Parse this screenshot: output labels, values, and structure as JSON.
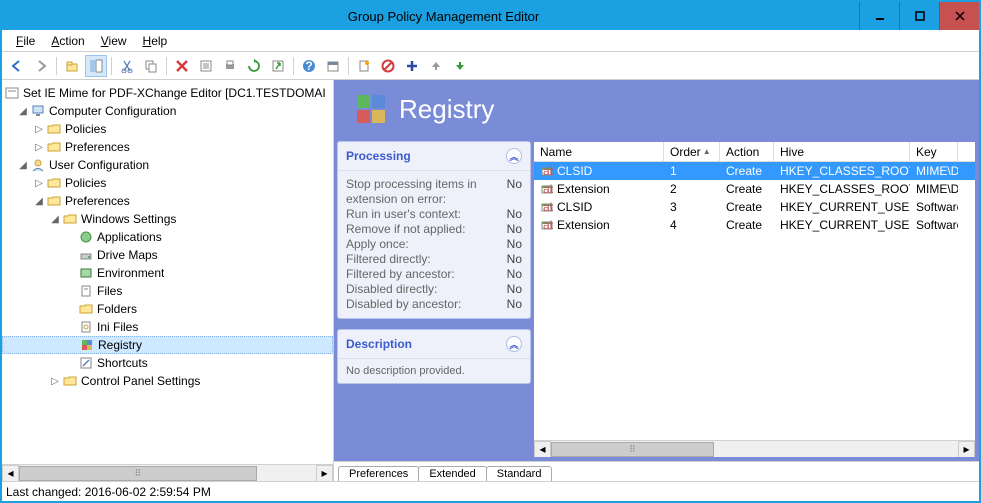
{
  "window": {
    "title": "Group Policy Management Editor"
  },
  "menu": {
    "file": "File",
    "action": "Action",
    "view": "View",
    "help": "Help"
  },
  "tree": {
    "root": "Set IE Mime for PDF-XChange Editor [DC1.TESTDOMAI",
    "computer_config": "Computer Configuration",
    "policies": "Policies",
    "preferences": "Preferences",
    "user_config": "User Configuration",
    "windows_settings": "Windows Settings",
    "applications": "Applications",
    "drive_maps": "Drive Maps",
    "environment": "Environment",
    "files": "Files",
    "folders": "Folders",
    "ini_files": "Ini Files",
    "registry": "Registry",
    "shortcuts": "Shortcuts",
    "control_panel": "Control Panel Settings"
  },
  "header": {
    "title": "Registry"
  },
  "processing": {
    "title": "Processing",
    "rows": [
      {
        "label": "Stop processing items in extension on error:",
        "value": "No"
      },
      {
        "label": "Run in user's context:",
        "value": "No"
      },
      {
        "label": "Remove if not applied:",
        "value": "No"
      },
      {
        "label": "Apply once:",
        "value": "No"
      },
      {
        "label": "Filtered directly:",
        "value": "No"
      },
      {
        "label": "Filtered by ancestor:",
        "value": "No"
      },
      {
        "label": "Disabled directly:",
        "value": "No"
      },
      {
        "label": "Disabled by ancestor:",
        "value": "No"
      }
    ]
  },
  "description": {
    "title": "Description",
    "body": "No description provided."
  },
  "columns": {
    "name": "Name",
    "order": "Order",
    "action": "Action",
    "hive": "Hive",
    "key": "Key"
  },
  "sort_icon": "▲",
  "rows": [
    {
      "name": "CLSID",
      "order": "1",
      "action": "Create",
      "hive": "HKEY_CLASSES_ROOT",
      "key": "MIME\\Database\\",
      "selected": true
    },
    {
      "name": "Extension",
      "order": "2",
      "action": "Create",
      "hive": "HKEY_CLASSES_ROOT",
      "key": "MIME\\Database\\"
    },
    {
      "name": "CLSID",
      "order": "3",
      "action": "Create",
      "hive": "HKEY_CURRENT_USER",
      "key": "Software\\"
    },
    {
      "name": "Extension",
      "order": "4",
      "action": "Create",
      "hive": "HKEY_CURRENT_USER",
      "key": "Software\\"
    }
  ],
  "tabs": {
    "preferences": "Preferences",
    "extended": "Extended",
    "standard": "Standard"
  },
  "status": "Last changed: 2016-06-02 2:59:54 PM"
}
